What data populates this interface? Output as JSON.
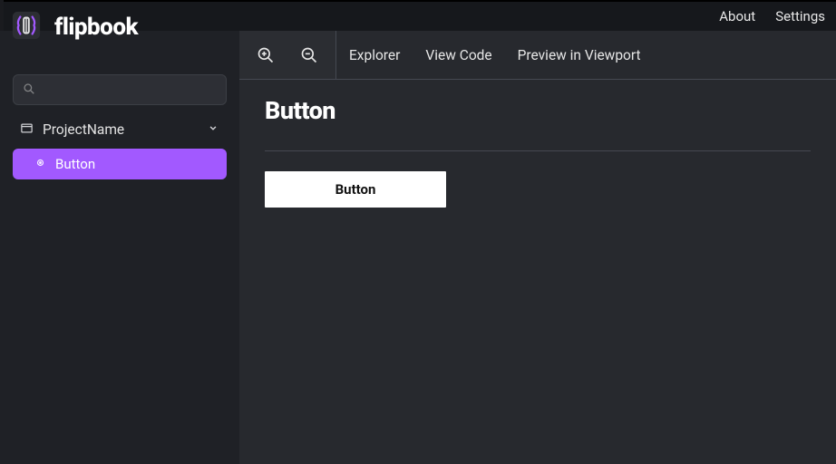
{
  "topbar": {
    "about": "About",
    "settings": "Settings"
  },
  "app_title": "flipbook",
  "search": {
    "placeholder": ""
  },
  "sidebar": {
    "project_name": "ProjectName",
    "items": [
      {
        "label": "Button",
        "selected": true
      }
    ]
  },
  "toolbar": {
    "explorer": "Explorer",
    "view_code": "View Code",
    "preview_viewport": "Preview in Viewport"
  },
  "content": {
    "title": "Button",
    "preview_button_label": "Button"
  }
}
